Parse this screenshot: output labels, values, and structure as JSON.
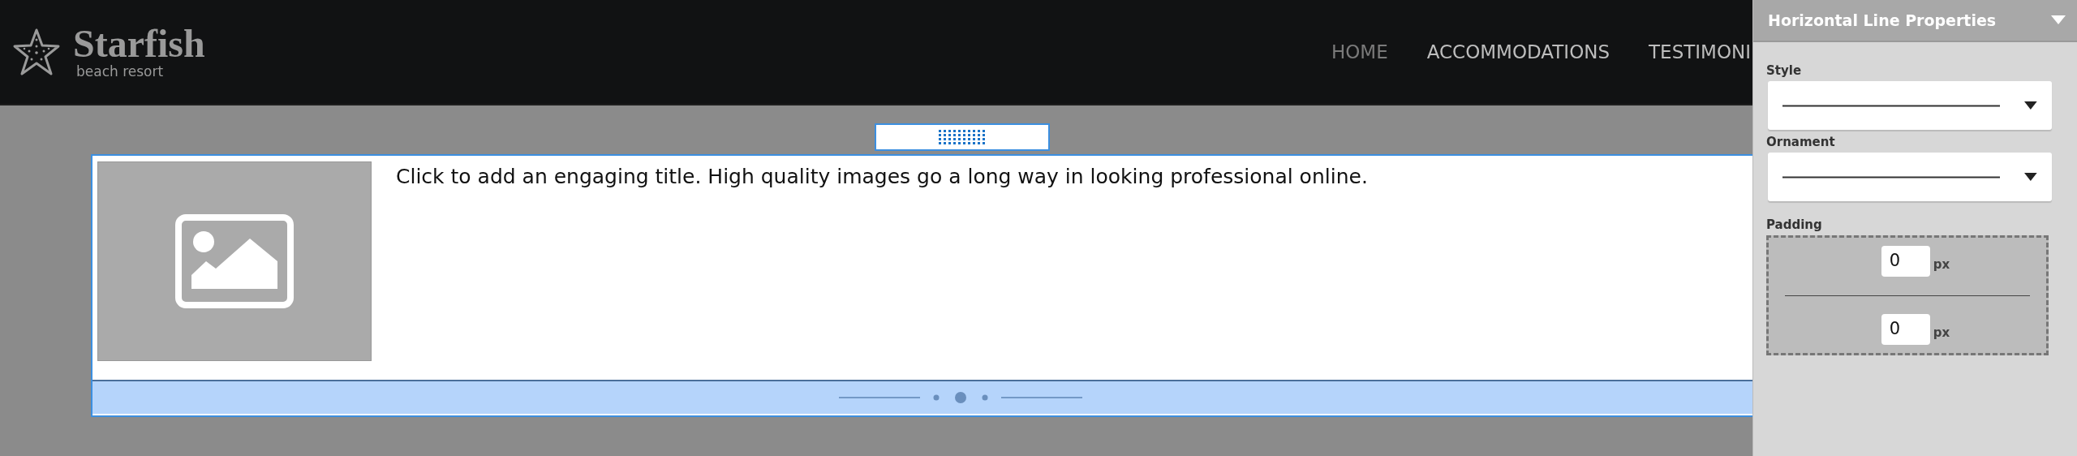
{
  "site": {
    "logo": {
      "name": "Starfish",
      "tagline": "beach resort"
    },
    "nav": [
      {
        "label": "HOME",
        "selected": true
      },
      {
        "label": "ACCOMMODATIONS",
        "selected": false
      },
      {
        "label": "TESTIMONI",
        "selected": false
      }
    ]
  },
  "block": {
    "title": "Click to add an engaging title. High quality images go a long way in looking professional online."
  },
  "panel": {
    "title": "Horizontal Line Properties",
    "dropdowns": [
      {
        "label": "Style"
      },
      {
        "label": "Ornament"
      }
    ],
    "padding": {
      "label": "Padding",
      "top": {
        "value": "0",
        "unit": "px"
      },
      "bottom": {
        "value": "0",
        "unit": "px"
      }
    }
  }
}
